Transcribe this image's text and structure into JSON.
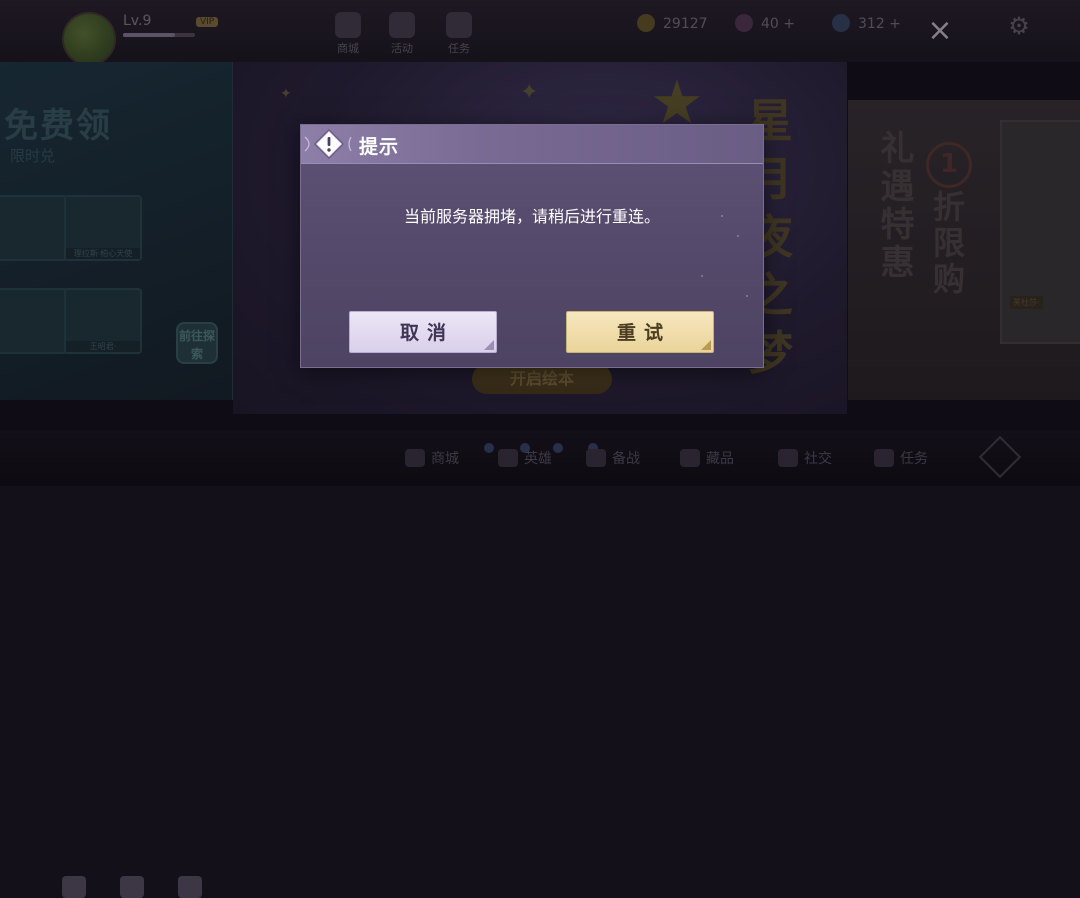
{
  "header": {
    "level": "Lv.9",
    "vip": "VIP",
    "nav_icons": [
      "商城",
      "活动",
      "任务"
    ],
    "coins": "29127",
    "gems": "40",
    "diamonds": "312"
  },
  "background": {
    "left_banner_title": "免费领",
    "left_banner_subtitle": "限时兑",
    "left_tiles": [
      "",
      "理拉斯·柏心天使",
      "",
      "王昭君·"
    ],
    "go_explore": "前往探索",
    "center_button": "开启绘本",
    "center_title": "星月夜之梦",
    "right_gift": "礼遇特惠",
    "right_discount": "折限购",
    "right_badge": "1",
    "right_card_tag": "芙杜莎·"
  },
  "bottom_nav": [
    "商城",
    "英雄",
    "备战",
    "藏品",
    "社交",
    "任务"
  ],
  "dialog": {
    "title": "提示",
    "message": "当前服务器拥堵，请稍后进行重连。",
    "cancel_label": "取消",
    "retry_label": "重试"
  },
  "colors": {
    "dialog_bg": "#54496a",
    "dialog_header": "#8d7fa8",
    "cancel_button": "#ece6f6",
    "retry_button": "#f6e7bd"
  }
}
